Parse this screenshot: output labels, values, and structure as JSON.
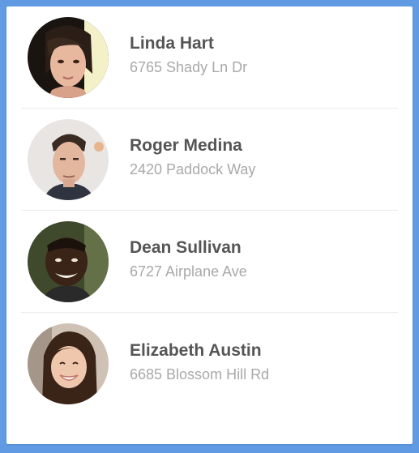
{
  "colors": {
    "background": "#5f9ae3",
    "card": "#ffffff",
    "name_text": "#555555",
    "address_text": "#a9a9a9",
    "divider": "#ececec"
  },
  "contacts": [
    {
      "name": "Linda Hart",
      "address": "6765 Shady Ln Dr",
      "avatar": "woman-portrait-dark-hair"
    },
    {
      "name": "Roger Medina",
      "address": "2420 Paddock Way",
      "avatar": "man-portrait-short-hair"
    },
    {
      "name": "Dean Sullivan",
      "address": "6727 Airplane Ave",
      "avatar": "man-portrait-smiling"
    },
    {
      "name": "Elizabeth Austin",
      "address": "6685 Blossom Hill Rd",
      "avatar": "woman-portrait-smiling"
    }
  ]
}
